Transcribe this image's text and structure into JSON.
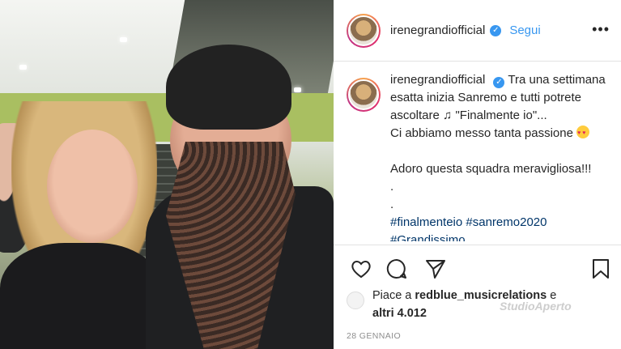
{
  "header": {
    "username": "irenegrandiofficial",
    "follow_label": "Segui",
    "more_label": "•••"
  },
  "caption": {
    "username": "irenegrandiofficial",
    "line1": "Tra una settimana esatta inizia Sanremo e tutti potrete ascoltare",
    "line2": "\"Finalmente io\"...",
    "line3": "Ci abbiamo messo tanta passione",
    "line4": "Adoro questa squadra meravigliosa!!!",
    "dot1": ".",
    "dot2": ".",
    "hashtag1": "#finalmenteio",
    "hashtag2": "#sanremo2020",
    "hashtag3": "#Grandissimo"
  },
  "likes": {
    "prefix": "Piace a",
    "user": "redblue_musicrelations",
    "conj": "e",
    "others": "altri 4.012"
  },
  "date": "28 GENNAIO",
  "watermark": "StudioAperto",
  "icons": [
    "verified-icon",
    "more-icon",
    "heart-icon",
    "comment-icon",
    "share-icon",
    "bookmark-icon",
    "music-note-icon",
    "heart-eyes-emoji"
  ],
  "colors": {
    "link": "#3897f0",
    "text": "#262626",
    "hashtag": "#003569",
    "muted": "#8e8e8e"
  }
}
